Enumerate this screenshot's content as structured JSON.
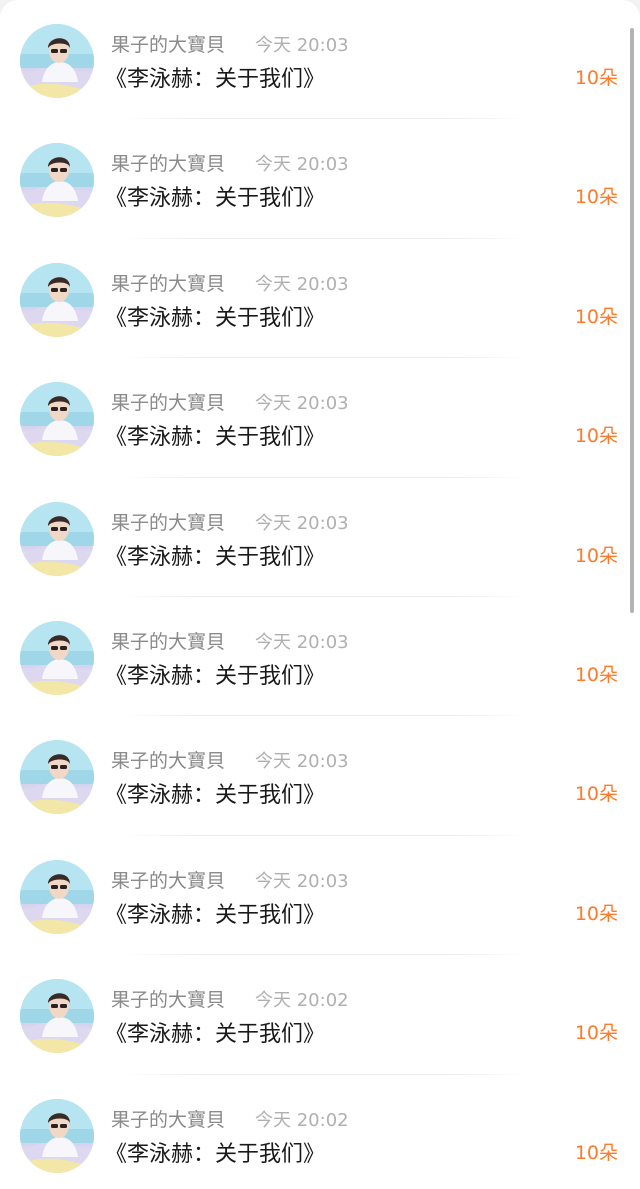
{
  "accent_color": "#ff7a2a",
  "items": [
    {
      "name": "果子的大寶貝",
      "time": "今天 20:03",
      "title": "《李泳赫：关于我们》",
      "amount": "10朵",
      "avatar_icon": "user-avatar-photo"
    },
    {
      "name": "果子的大寶貝",
      "time": "今天 20:03",
      "title": "《李泳赫：关于我们》",
      "amount": "10朵",
      "avatar_icon": "user-avatar-photo"
    },
    {
      "name": "果子的大寶貝",
      "time": "今天 20:03",
      "title": "《李泳赫：关于我们》",
      "amount": "10朵",
      "avatar_icon": "user-avatar-photo"
    },
    {
      "name": "果子的大寶貝",
      "time": "今天 20:03",
      "title": "《李泳赫：关于我们》",
      "amount": "10朵",
      "avatar_icon": "user-avatar-photo"
    },
    {
      "name": "果子的大寶貝",
      "time": "今天 20:03",
      "title": "《李泳赫：关于我们》",
      "amount": "10朵",
      "avatar_icon": "user-avatar-photo"
    },
    {
      "name": "果子的大寶貝",
      "time": "今天 20:03",
      "title": "《李泳赫：关于我们》",
      "amount": "10朵",
      "avatar_icon": "user-avatar-photo"
    },
    {
      "name": "果子的大寶貝",
      "time": "今天 20:03",
      "title": "《李泳赫：关于我们》",
      "amount": "10朵",
      "avatar_icon": "user-avatar-photo"
    },
    {
      "name": "果子的大寶貝",
      "time": "今天 20:03",
      "title": "《李泳赫：关于我们》",
      "amount": "10朵",
      "avatar_icon": "user-avatar-photo"
    },
    {
      "name": "果子的大寶貝",
      "time": "今天 20:02",
      "title": "《李泳赫：关于我们》",
      "amount": "10朵",
      "avatar_icon": "user-avatar-photo"
    },
    {
      "name": "果子的大寶貝",
      "time": "今天 20:02",
      "title": "《李泳赫：关于我们》",
      "amount": "10朵",
      "avatar_icon": "user-avatar-photo"
    }
  ]
}
